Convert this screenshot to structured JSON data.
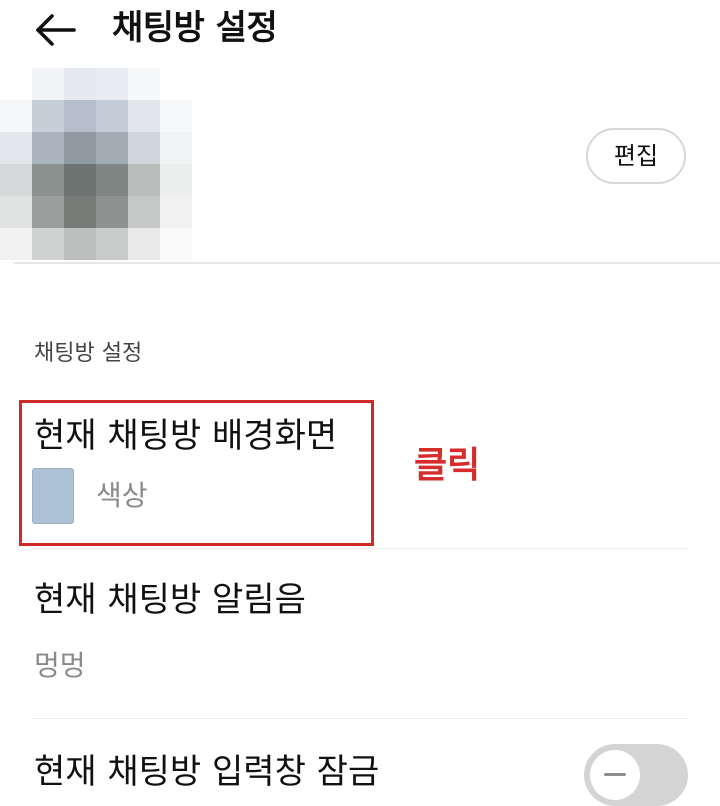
{
  "header": {
    "back_icon": "arrow-left-icon",
    "title": "채팅방 설정"
  },
  "profile": {
    "edit_label": "편집",
    "image_note": "pixelated profile image"
  },
  "settings": {
    "section_label": "채팅방 설정",
    "background": {
      "title": "현재 채팅방 배경화면",
      "value": "색상",
      "swatch_color": "#acc1d5"
    },
    "sound": {
      "title": "현재 채팅방 알림음",
      "value": "멍멍"
    },
    "input_lock": {
      "title": "현재 채팅방 입력창 잠금",
      "enabled": false
    }
  },
  "annotation": {
    "label": "클릭",
    "color": "#d62c2c"
  }
}
